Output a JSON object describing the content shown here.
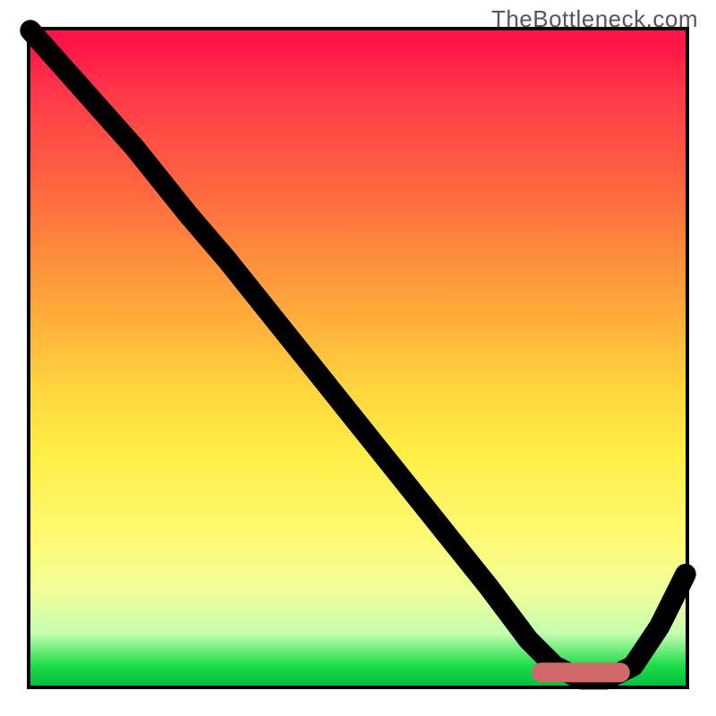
{
  "watermark": "TheBottleneck.com",
  "colors": {
    "frame": "#000000",
    "curve": "#000000",
    "marker": "#d06a6a",
    "gradient_stops": [
      "#ff1547",
      "#ff3a4a",
      "#ff6a3e",
      "#ff8f3c",
      "#ffb23b",
      "#ffd63e",
      "#ffef47",
      "#fffb77",
      "#efff9a",
      "#c6ffb0",
      "#1cdc4a",
      "#00c23a"
    ]
  },
  "chart_data": {
    "type": "line",
    "title": "",
    "xlabel": "",
    "ylabel": "",
    "xlim": [
      0,
      100
    ],
    "ylim": [
      0,
      100
    ],
    "grid": false,
    "legend": false,
    "series": [
      {
        "name": "bottleneck-curve",
        "x": [
          0,
          8,
          16,
          24,
          30,
          38,
          46,
          54,
          62,
          70,
          76,
          80,
          84,
          88,
          92,
          96,
          100
        ],
        "y": [
          100,
          91,
          82,
          72,
          65,
          55,
          45,
          35,
          25,
          15,
          7,
          3,
          1,
          1,
          3,
          9,
          17
        ]
      }
    ],
    "annotations": [
      {
        "name": "optimal-range-marker",
        "x_start": 78,
        "x_end": 90,
        "y": 2
      }
    ]
  }
}
